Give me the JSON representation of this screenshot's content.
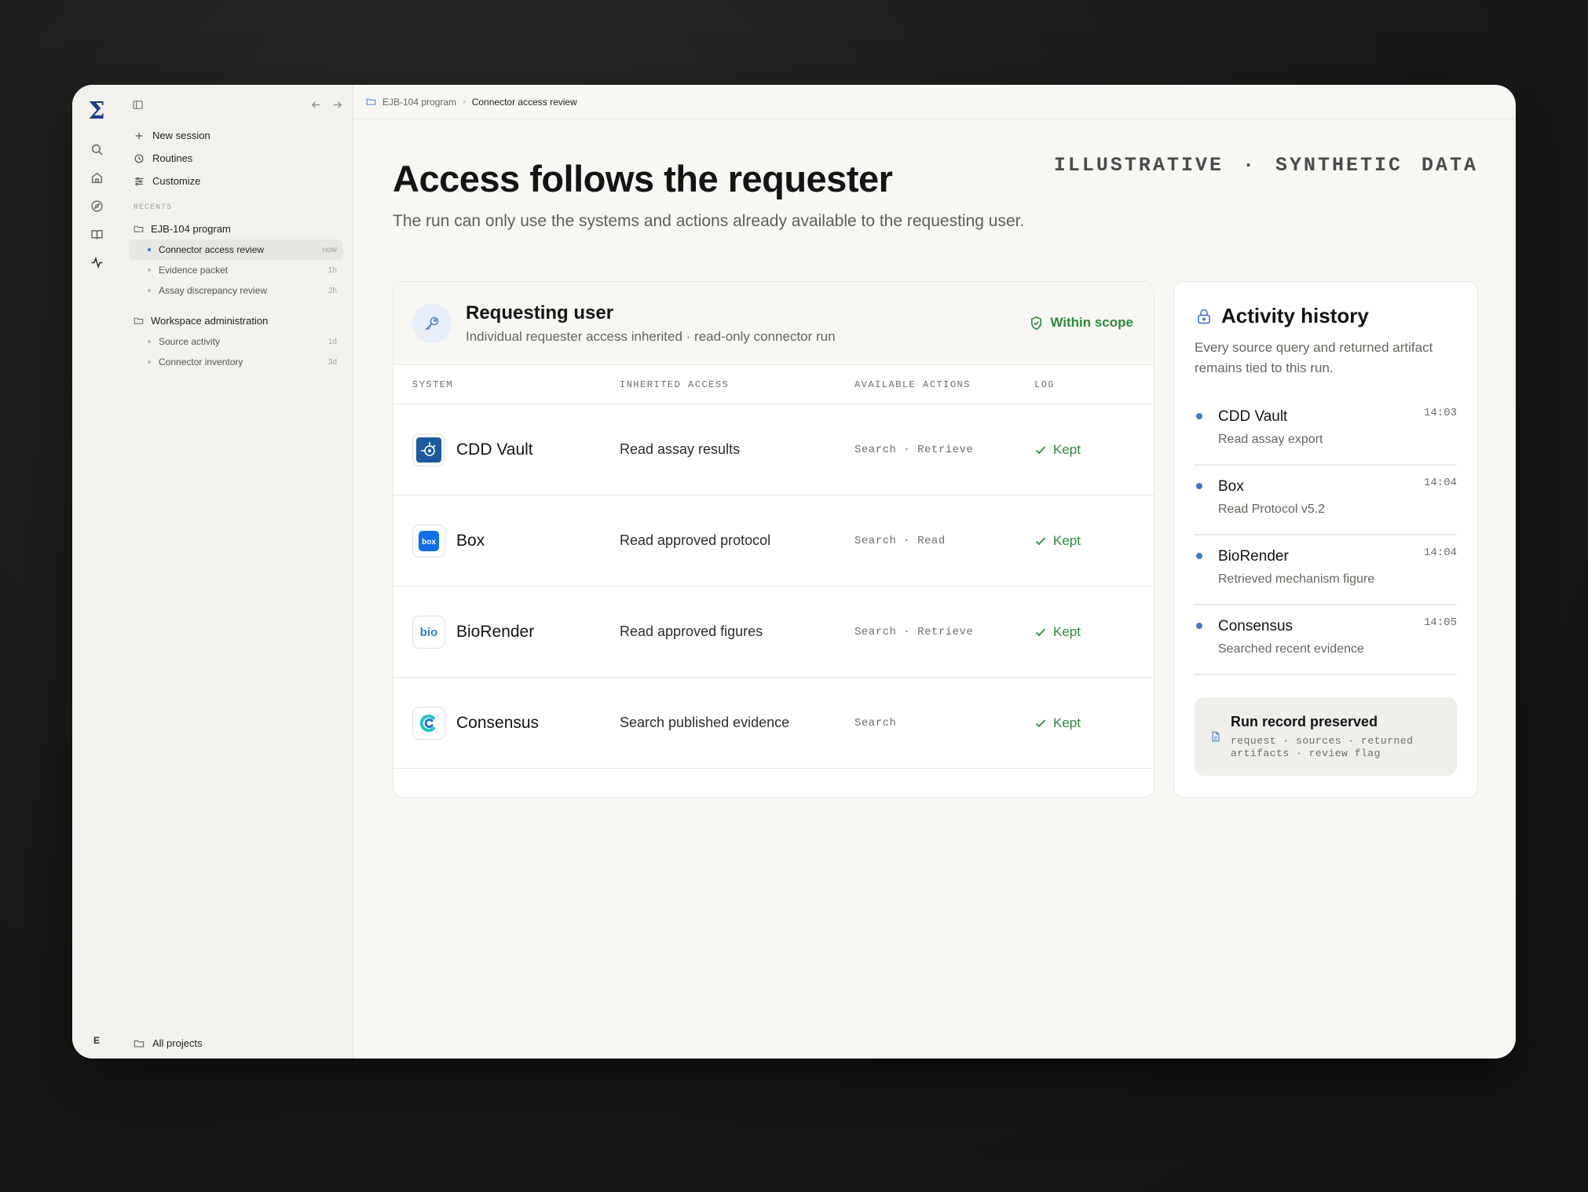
{
  "stamp": "ILLUSTRATIVE · SYNTHETIC DATA",
  "rail": {
    "user_initial": "E"
  },
  "sidebar": {
    "actions": [
      {
        "label": "New session",
        "icon": "plus-icon"
      },
      {
        "label": "Routines",
        "icon": "clock-icon"
      },
      {
        "label": "Customize",
        "icon": "sliders-icon"
      }
    ],
    "recents_label": "RECENTS",
    "groups": [
      {
        "folder": "EJB-104 program",
        "items": [
          {
            "label": "Connector access review",
            "time": "now",
            "active": true
          },
          {
            "label": "Evidence packet",
            "time": "1h"
          },
          {
            "label": "Assay discrepancy review",
            "time": "2h"
          }
        ]
      },
      {
        "folder": "Workspace administration",
        "items": [
          {
            "label": "Source activity",
            "time": "1d"
          },
          {
            "label": "Connector inventory",
            "time": "3d"
          }
        ]
      }
    ],
    "bottom_label": "All projects"
  },
  "breadcrumb": {
    "project": "EJB-104 program",
    "current": "Connector access review"
  },
  "page": {
    "title": "Access follows the requester",
    "subtitle": "The run can only use the systems and actions already available to the requesting user."
  },
  "user_card": {
    "title": "Requesting user",
    "subtitle": "Individual requester access inherited · read-only connector run",
    "scope": "Within scope",
    "columns": [
      "SYSTEM",
      "INHERITED ACCESS",
      "AVAILABLE ACTIONS",
      "LOG"
    ],
    "rows": [
      {
        "system": "CDD Vault",
        "access": "Read assay results",
        "actions": "Search · Retrieve",
        "log": "Kept",
        "logo": "cdd-vault-logo"
      },
      {
        "system": "Box",
        "access": "Read approved protocol",
        "actions": "Search · Read",
        "log": "Kept",
        "logo": "box-logo"
      },
      {
        "system": "BioRender",
        "access": "Read approved figures",
        "actions": "Search · Retrieve",
        "log": "Kept",
        "logo": "biorender-logo"
      },
      {
        "system": "Consensus",
        "access": "Search published evidence",
        "actions": "Search",
        "log": "Kept",
        "logo": "consensus-logo"
      }
    ]
  },
  "activity": {
    "title": "Activity history",
    "description": "Every source query and returned artifact remains tied to this run.",
    "items": [
      {
        "name": "CDD Vault",
        "detail": "Read assay export",
        "time": "14:03"
      },
      {
        "name": "Box",
        "detail": "Read Protocol v5.2",
        "time": "14:04"
      },
      {
        "name": "BioRender",
        "detail": "Retrieved mechanism figure",
        "time": "14:04"
      },
      {
        "name": "Consensus",
        "detail": "Searched recent evidence",
        "time": "14:05"
      }
    ],
    "record_title": "Run record preserved",
    "record_line1": "request · sources · returned",
    "record_line2": "artifacts · review flag"
  },
  "colors": {
    "accent": "#3c7ac7",
    "success": "#2e8a3c",
    "brand": "#1d3d8a"
  }
}
